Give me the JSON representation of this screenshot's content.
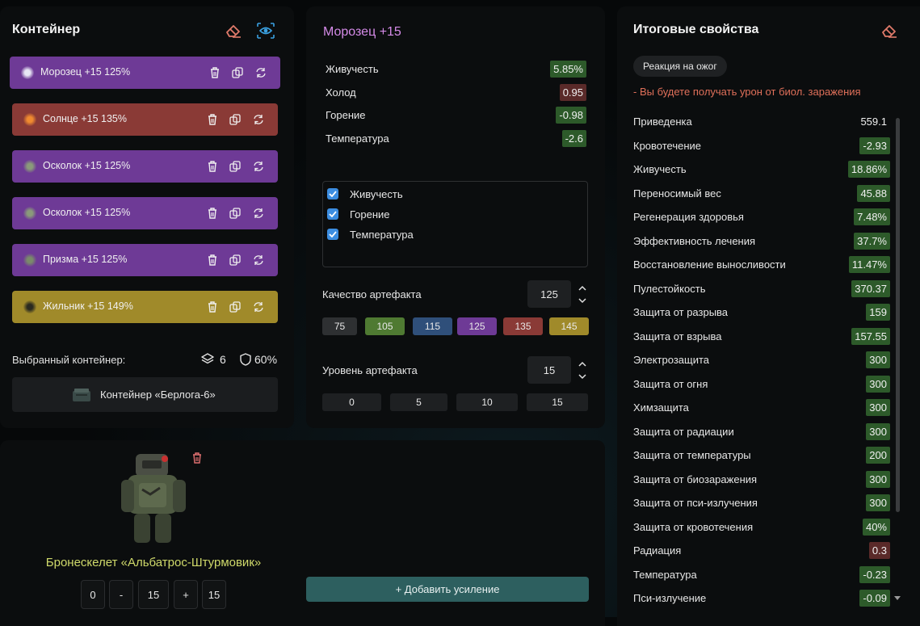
{
  "container_panel": {
    "title": "Контейнер",
    "artifacts": [
      {
        "label": "Морозец +15 125%",
        "color": "#6e3a96",
        "icon_color": "#e8e8f5"
      },
      {
        "label": "Солнце +15 135%",
        "color": "#8a3a36",
        "icon_color": "#f08a30"
      },
      {
        "label": "Осколок +15 125%",
        "color": "#6e3a96",
        "icon_color": "#8a9a7a"
      },
      {
        "label": "Осколок +15 125%",
        "color": "#6e3a96",
        "icon_color": "#8a9a7a"
      },
      {
        "label": "Призма +15 125%",
        "color": "#6e3a96",
        "icon_color": "#7a8a6a"
      },
      {
        "label": "Жильник +15 149%",
        "color": "#a08a2a",
        "icon_color": "#2a2a20"
      }
    ],
    "selected_label": "Выбранный контейнер:",
    "slots": "6",
    "protection": "60%",
    "container_name": "Контейнер «Берлога-6»"
  },
  "artifact_panel": {
    "title": "Морозец +15",
    "stats": [
      {
        "label": "Живучесть",
        "value": "5.85%",
        "kind": "g"
      },
      {
        "label": "Холод",
        "value": "0.95",
        "kind": "r"
      },
      {
        "label": "Горение",
        "value": "-0.98",
        "kind": "g"
      },
      {
        "label": "Температура",
        "value": "-2.6",
        "kind": "g"
      }
    ],
    "checks": [
      "Живучесть",
      "Горение",
      "Температура"
    ],
    "quality_label": "Качество артефакта",
    "quality_value": "125",
    "quality_options": [
      {
        "label": "75",
        "color": "#2e3032"
      },
      {
        "label": "105",
        "color": "#4f7a32"
      },
      {
        "label": "115",
        "color": "#2f4f7a"
      },
      {
        "label": "125",
        "color": "#6e3a96"
      },
      {
        "label": "135",
        "color": "#8a3a36"
      },
      {
        "label": "145",
        "color": "#a08a2a"
      }
    ],
    "level_label": "Уровень артефакта",
    "level_value": "15",
    "level_options": [
      "0",
      "5",
      "10",
      "15"
    ]
  },
  "armor_panel": {
    "name": "Бронескелет «Альбатрос-Штурмовик»",
    "min": "0",
    "minus": "-",
    "value": "15",
    "plus": "+",
    "max": "15",
    "add_button": "+ Добавить усиление"
  },
  "final_panel": {
    "title": "Итоговые свойства",
    "reaction_badge": "Реакция на ожог",
    "warning": "- Вы будете получать урон от биол. заражения",
    "rows": [
      {
        "label": "Приведенка",
        "value": "559.1",
        "kind": "plain"
      },
      {
        "label": "Кровотечение",
        "value": "-2.93",
        "kind": "g"
      },
      {
        "label": "Живучесть",
        "value": "18.86%",
        "kind": "g"
      },
      {
        "label": "Переносимый вес",
        "value": "45.88",
        "kind": "g"
      },
      {
        "label": "Регенерация здоровья",
        "value": "7.48%",
        "kind": "g"
      },
      {
        "label": "Эффективность лечения",
        "value": "37.7%",
        "kind": "g"
      },
      {
        "label": "Восстановление выносливости",
        "value": "11.47%",
        "kind": "g"
      },
      {
        "label": "Пулестойкость",
        "value": "370.37",
        "kind": "g"
      },
      {
        "label": "Защита от разрыва",
        "value": "159",
        "kind": "g"
      },
      {
        "label": "Защита от взрыва",
        "value": "157.55",
        "kind": "g"
      },
      {
        "label": "Электрозащита",
        "value": "300",
        "kind": "g"
      },
      {
        "label": "Защита от огня",
        "value": "300",
        "kind": "g"
      },
      {
        "label": "Химзащита",
        "value": "300",
        "kind": "g"
      },
      {
        "label": "Защита от радиации",
        "value": "300",
        "kind": "g"
      },
      {
        "label": "Защита от температуры",
        "value": "200",
        "kind": "g"
      },
      {
        "label": "Защита от биозаражения",
        "value": "300",
        "kind": "g"
      },
      {
        "label": "Защита от пси-излучения",
        "value": "300",
        "kind": "g"
      },
      {
        "label": "Защита от кровотечения",
        "value": "40%",
        "kind": "g"
      },
      {
        "label": "Радиация",
        "value": "0.3",
        "kind": "r"
      },
      {
        "label": "Температура",
        "value": "-0.23",
        "kind": "g"
      },
      {
        "label": "Пси-излучение",
        "value": "-0.09",
        "kind": "g"
      }
    ]
  },
  "colors": {
    "accent_purple": "#d58be8",
    "armor_name": "#cfd96a",
    "warning": "#e0705a",
    "teal_button": "#2d5f5f",
    "eraser": "#e07a6a",
    "eye": "#3aa0e0"
  },
  "icons": {
    "eraser": "eraser-icon",
    "eye": "eye-icon",
    "trash": "trash-icon",
    "copy": "copy-icon",
    "refresh": "refresh-icon",
    "layers": "layers-icon",
    "shield": "shield-icon",
    "check": "check-icon"
  }
}
